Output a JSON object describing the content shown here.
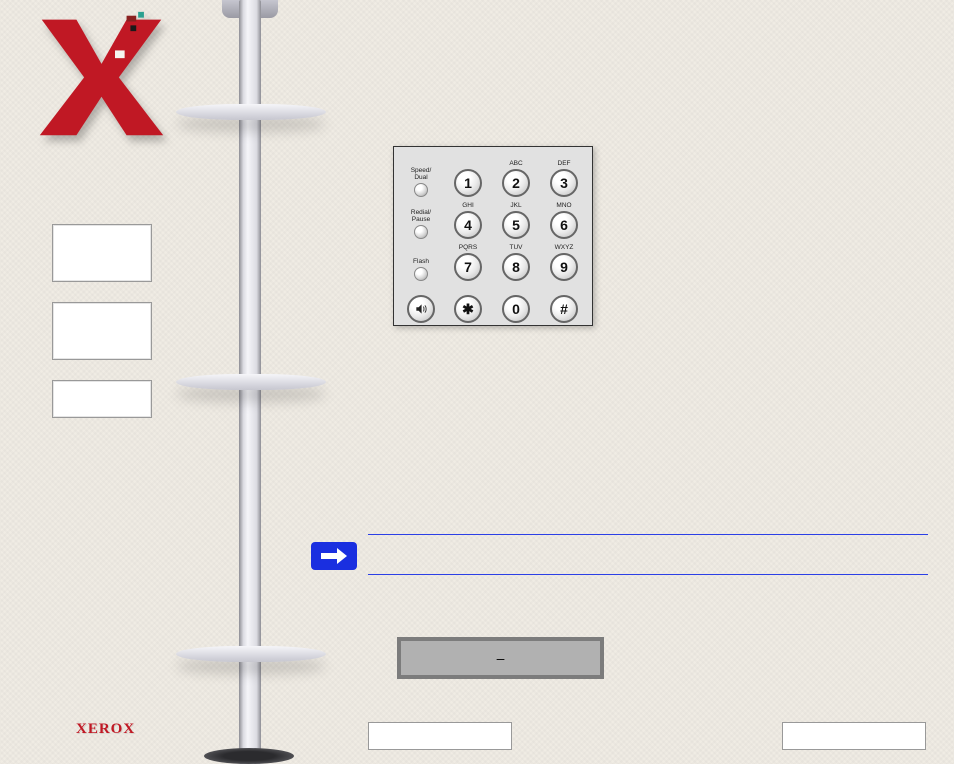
{
  "brand": {
    "name": "XEROX"
  },
  "keypad": {
    "side": [
      {
        "label": "Speed/\nDual"
      },
      {
        "label": "Redial/\nPause"
      },
      {
        "label": "Flash"
      }
    ],
    "rows": [
      [
        {
          "label": "",
          "glyph": "1"
        },
        {
          "label": "ABC",
          "glyph": "2"
        },
        {
          "label": "DEF",
          "glyph": "3"
        }
      ],
      [
        {
          "label": "GHI",
          "glyph": "4"
        },
        {
          "label": "JKL",
          "glyph": "5"
        },
        {
          "label": "MNO",
          "glyph": "6"
        }
      ],
      [
        {
          "label": "PQRS",
          "glyph": "7"
        },
        {
          "label": "TUV",
          "glyph": "8"
        },
        {
          "label": "WXYZ",
          "glyph": "9"
        }
      ],
      [
        {
          "label": "",
          "glyph": "✱"
        },
        {
          "label": "",
          "glyph": "0"
        },
        {
          "label": "",
          "glyph": "#"
        }
      ]
    ],
    "speakerKey": {
      "label": ""
    }
  },
  "search": {
    "label": "–"
  }
}
